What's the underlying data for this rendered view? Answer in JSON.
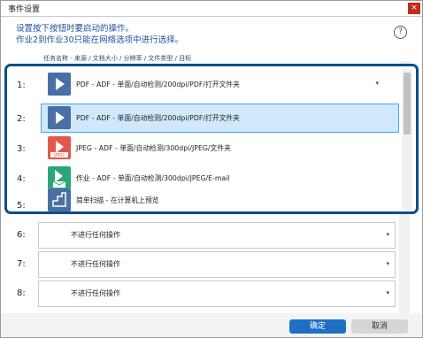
{
  "window": {
    "title": "事件设置",
    "close_glyph": "×"
  },
  "instructions": [
    "设置按下按钮时要启动的操作。",
    "作业2到作业30只能在网络选项中进行选择。"
  ],
  "help_glyph": "?",
  "column_header": "任务名称 - 来源 / 文档大小 / 分辨率 / 文件类型 / 目标",
  "rows": [
    {
      "num": "6:",
      "text": "不进行任何操作"
    },
    {
      "num": "7:",
      "text": "不进行任何操作"
    },
    {
      "num": "8:",
      "text": "不进行任何操作"
    }
  ],
  "caret": "▾",
  "dropdown": {
    "items": [
      {
        "num": "1:",
        "text": "PDF - ADF - 单面/自动检测/200dpi/PDF/打开文件夹",
        "icon": "pdf-icon"
      },
      {
        "num": "2:",
        "text": "PDF - ADF - 单面/自动检测/200dpi/PDF/打开文件夹",
        "icon": "pdf-icon",
        "selected": true
      },
      {
        "num": "3:",
        "text": "JPEG - ADF - 单面/自动检测/300dpi/JPEG/文件夹",
        "icon": "jpeg-icon"
      },
      {
        "num": "4:",
        "text": "作业 - ADF - 单面/自动检测/300dpi/JPEG/E-mail",
        "icon": "email-icon"
      },
      {
        "num": "5:",
        "text": "简单扫描 - 在计算机上预览",
        "icon": "scan-icon"
      }
    ],
    "icon_colors": {
      "pdf": "#4a6fa5",
      "jpeg": "#e4574c",
      "email": "#2aa67a",
      "scan": "#4a6fa5"
    }
  },
  "buttons": {
    "ok": "确定",
    "cancel": "取消"
  }
}
